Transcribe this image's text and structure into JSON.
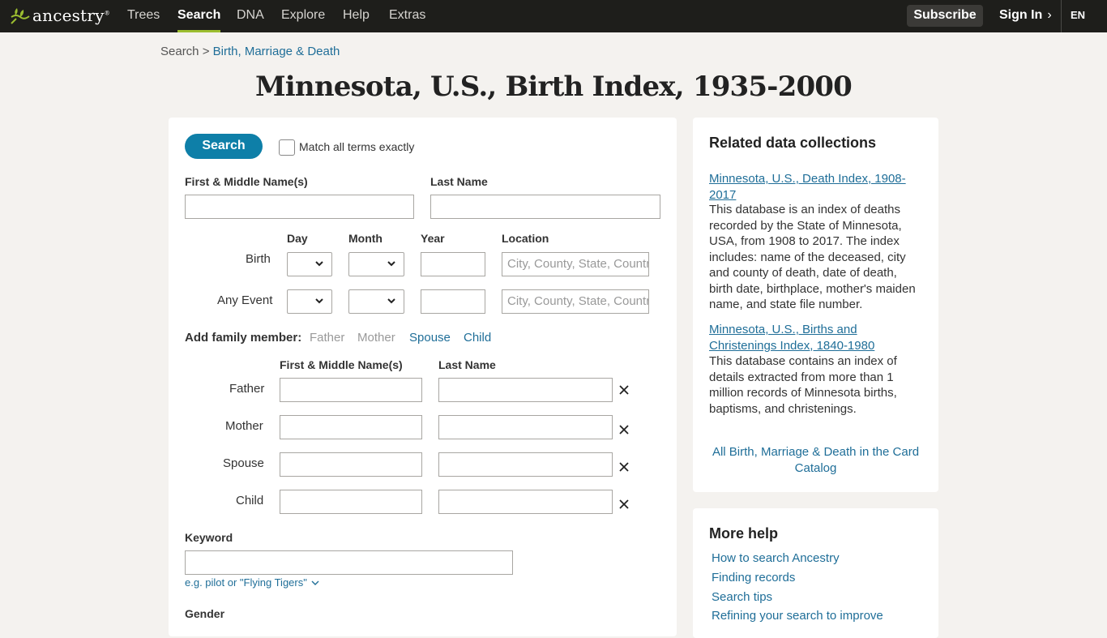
{
  "nav": {
    "logo": "ancestry",
    "logo_tm": "®",
    "items": [
      "Trees",
      "Search",
      "DNA",
      "Explore",
      "Help",
      "Extras"
    ],
    "subscribe": "Subscribe",
    "signin": "Sign In",
    "lang": "EN"
  },
  "breadcrumb": {
    "root": "Search",
    "sep": " > ",
    "current": "Birth, Marriage & Death"
  },
  "page_title": "Minnesota, U.S., Birth Index, 1935-2000",
  "form": {
    "search_label": "Search",
    "match_exact": "Match all terms exactly",
    "first_name": "First & Middle Name(s)",
    "last_name": "Last Name",
    "col_day": "Day",
    "col_month": "Month",
    "col_year": "Year",
    "col_location": "Location",
    "row_birth": "Birth",
    "row_any": "Any Event",
    "location_placeholder": "City, County, State, Country",
    "family_label": "Add family member:",
    "family_links": [
      "Father",
      "Mother",
      "Spouse",
      "Child"
    ],
    "family_first": "First & Middle Name(s)",
    "family_last": "Last Name",
    "family_rows": [
      "Father",
      "Mother",
      "Spouse",
      "Child"
    ],
    "keyword_label": "Keyword",
    "keyword_hint": "e.g. pilot or \"Flying Tigers\"",
    "gender_label": "Gender"
  },
  "related": {
    "heading": "Related data collections",
    "items": [
      {
        "link": "Minnesota, U.S., Death Index, 1908-2017",
        "desc": "This database is an index of deaths recorded by the State of Minnesota, USA, from 1908 to 2017. The index includes: name of the deceased, city and county of death, date of death, birth date, birthplace, mother's maiden name, and state file number."
      },
      {
        "link": "Minnesota, U.S., Births and Christenings Index, 1840-1980",
        "desc": "This database contains an index of details extracted from more than 1 million records of Minnesota births, baptisms, and christenings."
      }
    ],
    "all_link": "All Birth, Marriage & Death in the Card Catalog"
  },
  "help": {
    "heading": "More help",
    "links": [
      "How to search Ancestry",
      "Finding records",
      "Search tips",
      "Refining your search to improve"
    ]
  },
  "colors": {
    "nav_bg": "#1e1e1b",
    "accent_green": "#9cbe30",
    "button_blue": "#0e7fa8",
    "link_blue": "#1f6e98",
    "page_bg": "#f4f2ef"
  }
}
